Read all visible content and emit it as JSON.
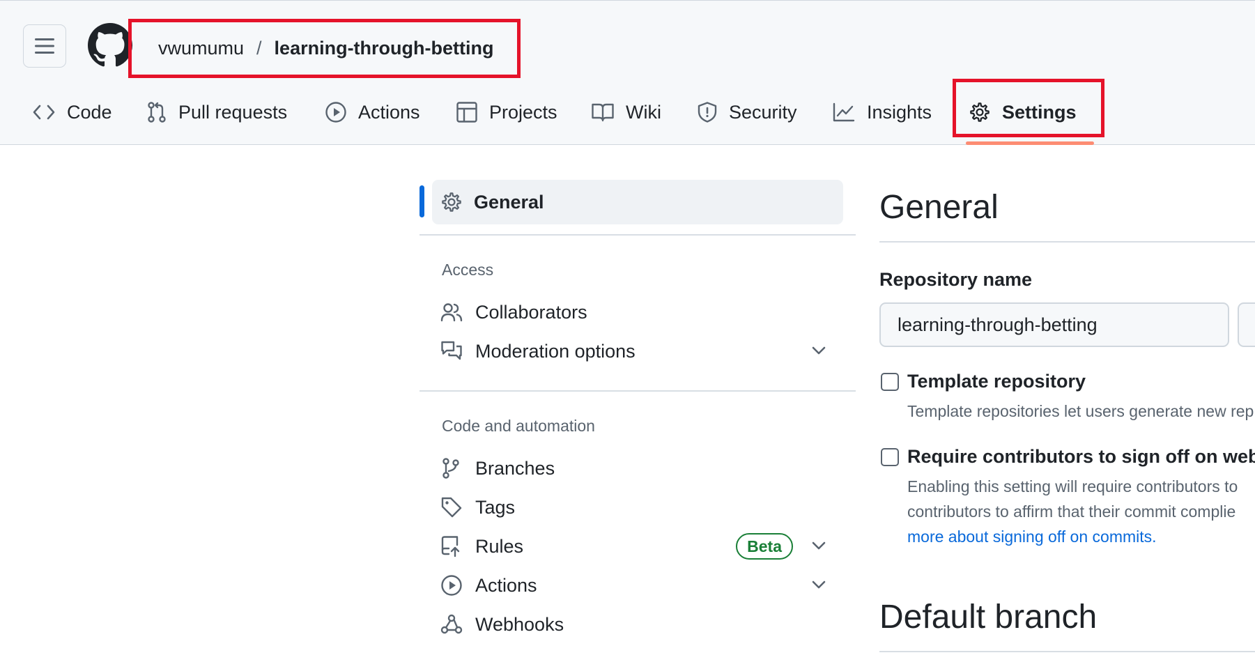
{
  "header": {
    "owner": "vwumumu",
    "separator": "/",
    "repo": "learning-through-betting"
  },
  "nav": {
    "tabs": [
      {
        "label": "Code",
        "icon": "code-icon"
      },
      {
        "label": "Pull requests",
        "icon": "git-pull-request-icon"
      },
      {
        "label": "Actions",
        "icon": "play-icon"
      },
      {
        "label": "Projects",
        "icon": "table-icon"
      },
      {
        "label": "Wiki",
        "icon": "book-icon"
      },
      {
        "label": "Security",
        "icon": "shield-icon"
      },
      {
        "label": "Insights",
        "icon": "graph-icon"
      },
      {
        "label": "Settings",
        "icon": "gear-icon",
        "selected": true
      }
    ]
  },
  "sidebar": {
    "general": "General",
    "access_heading": "Access",
    "access_items": [
      {
        "label": "Collaborators",
        "icon": "people-icon"
      },
      {
        "label": "Moderation options",
        "icon": "comment-discussion-icon",
        "expandable": true
      }
    ],
    "code_heading": "Code and automation",
    "code_items": [
      {
        "label": "Branches",
        "icon": "git-branch-icon"
      },
      {
        "label": "Tags",
        "icon": "tag-icon"
      },
      {
        "label": "Rules",
        "icon": "repo-push-icon",
        "badge": "Beta",
        "expandable": true
      },
      {
        "label": "Actions",
        "icon": "play-icon",
        "expandable": true
      },
      {
        "label": "Webhooks",
        "icon": "webhook-icon"
      }
    ]
  },
  "main": {
    "title": "General",
    "repo_name_label": "Repository name",
    "repo_name_value": "learning-through-betting",
    "template": {
      "label": "Template repository",
      "desc": "Template repositories let users generate new rep"
    },
    "signoff": {
      "label": "Require contributors to sign off on web-",
      "desc_line1": "Enabling this setting will require contributors to",
      "desc_line2": "contributors to affirm that their commit complie",
      "link": "more about signing off on commits."
    },
    "default_branch_title": "Default branch"
  },
  "colors": {
    "accent_blue": "#0969da",
    "highlight_red": "#e5132a",
    "selected_underline": "#fd8c73",
    "beta_green": "#1a7f37"
  }
}
